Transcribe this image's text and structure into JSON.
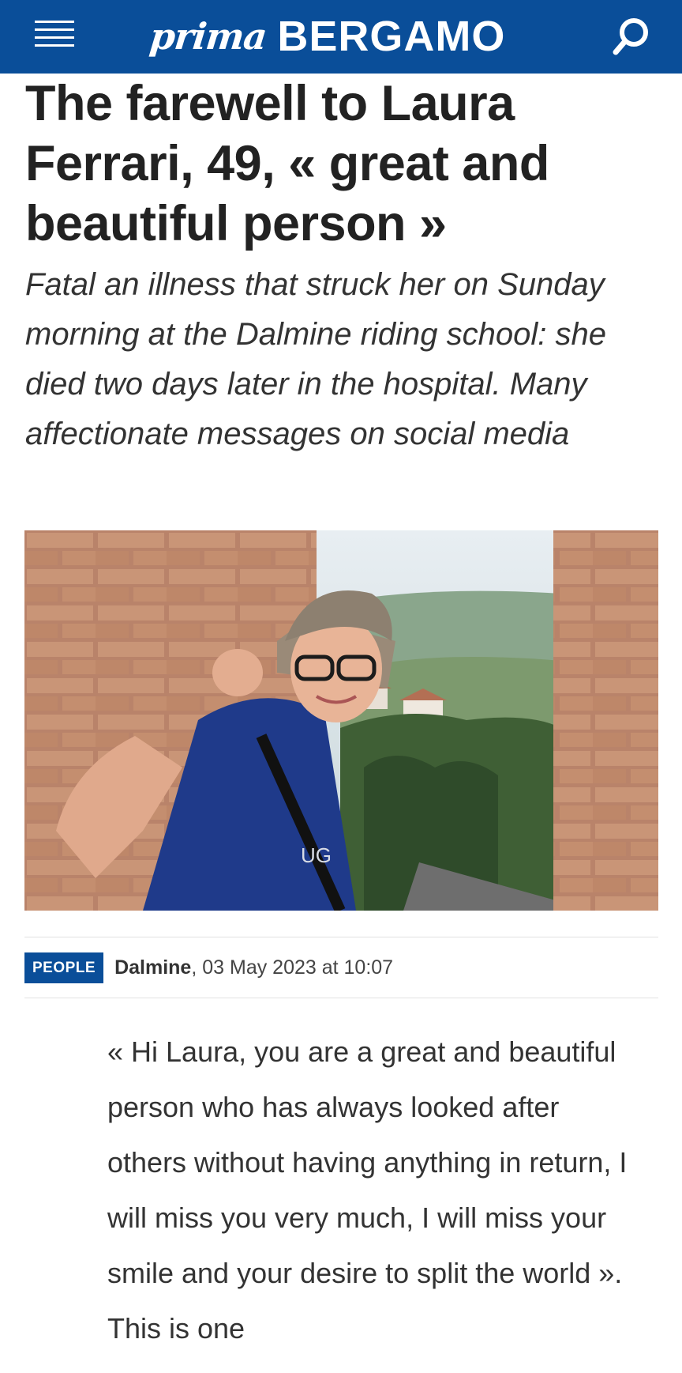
{
  "header": {
    "logo_prima": "prima",
    "logo_city": "BERGAMO",
    "menu_icon": "hamburger-menu-icon",
    "search_icon": "search-icon",
    "brand_color": "#0a4e99"
  },
  "article": {
    "title": "The farewell to Laura Ferrari, 49, « great and beautiful person »",
    "subtitle": "Fatal an illness that struck her on Sunday morning at the Dalmine riding school: she died two days later in the hospital. Many affectionate messages on social media",
    "photo": "photo-of-woman-with-glasses-between-brick-walls",
    "category": "PEOPLE",
    "place": "Dalmine",
    "date": ", 03 May 2023 at 10:07",
    "body": "« Hi Laura, you are a great and beautiful person who has always looked after others without having anything in return, I will miss you very much, I will miss your smile and your desire to split the world ». This is one"
  }
}
